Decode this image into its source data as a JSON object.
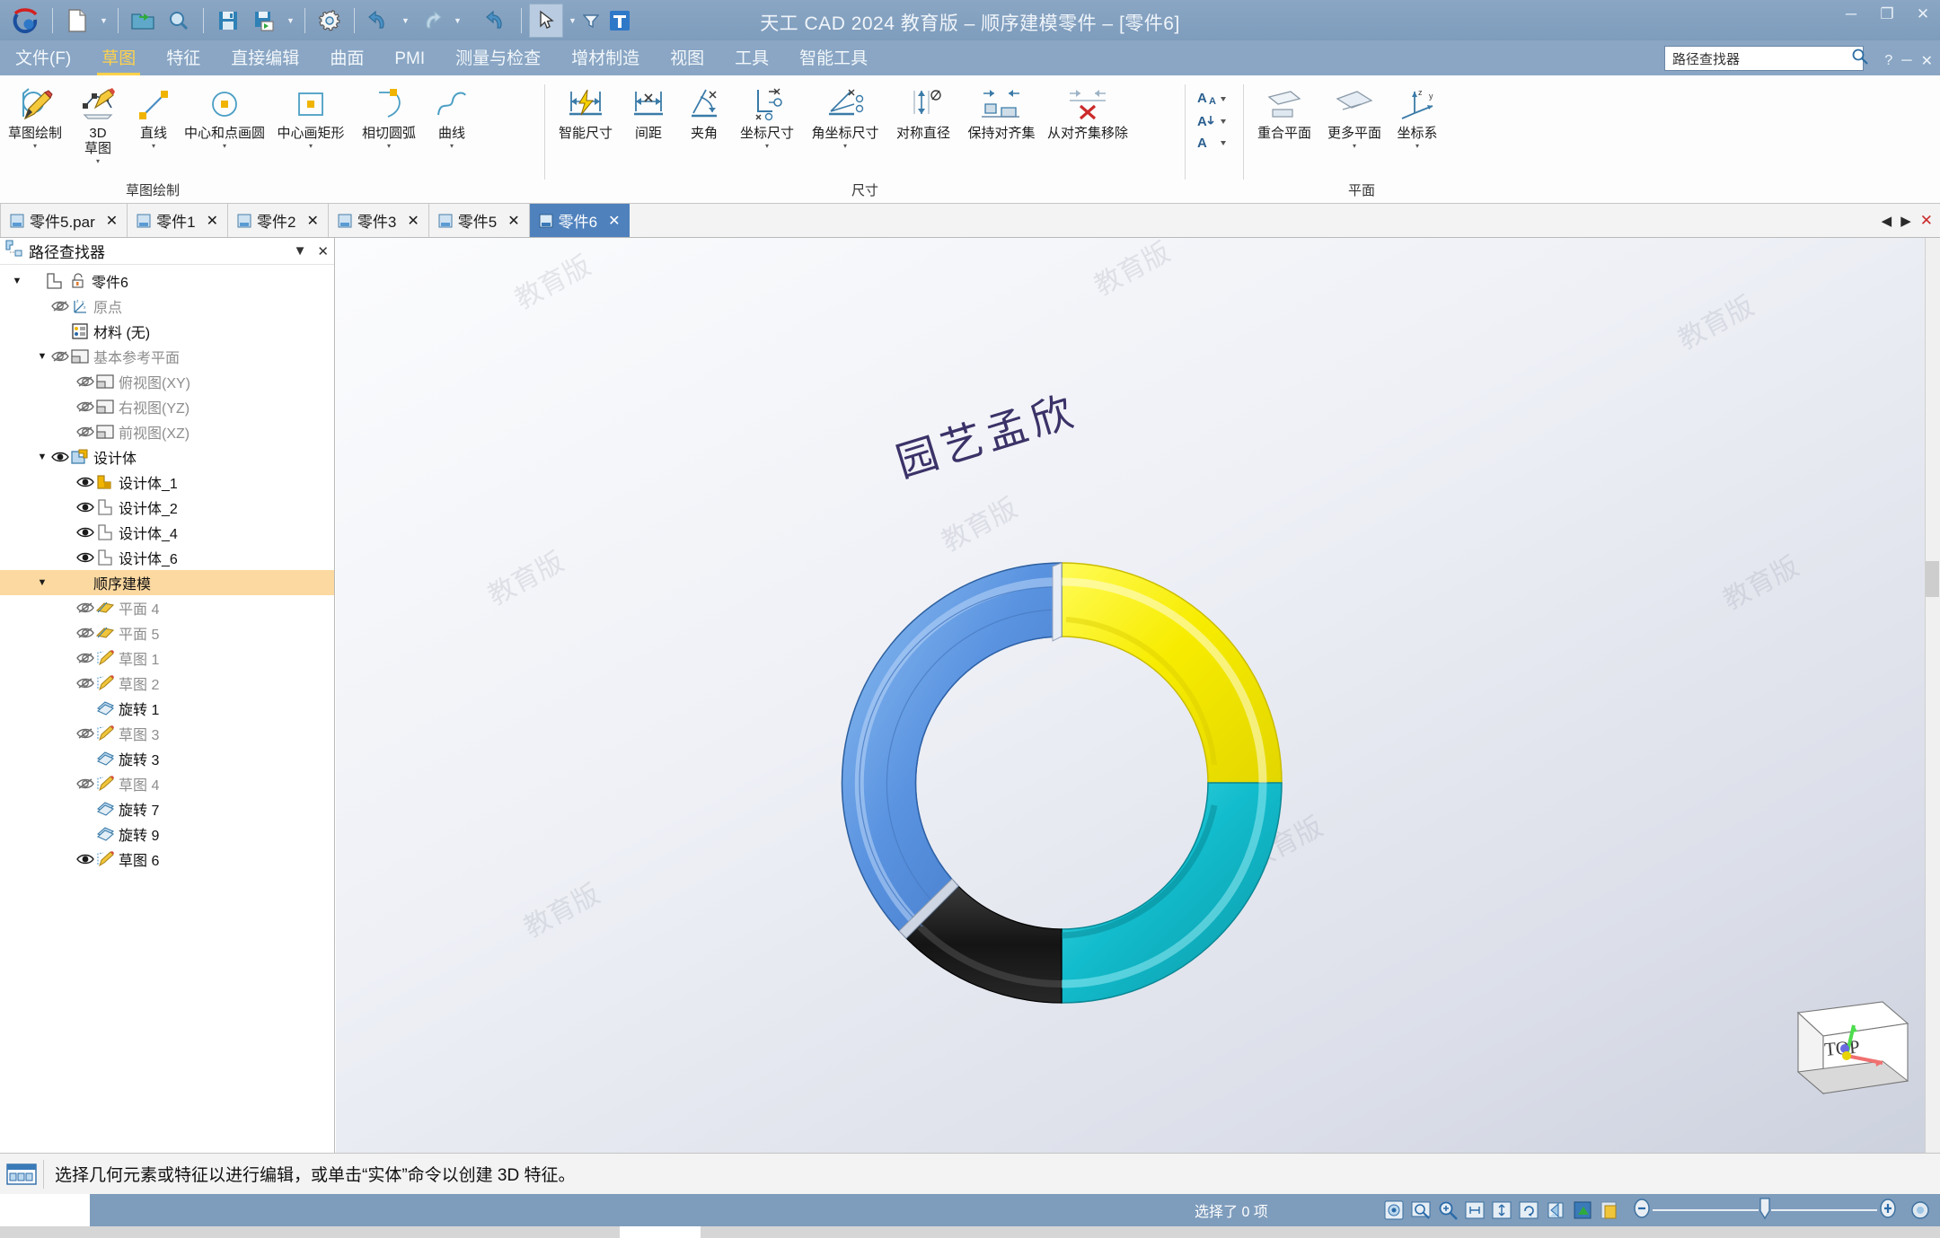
{
  "window": {
    "title": "天工 CAD 2024 教育版 – 顺序建模零件 – [零件6]",
    "minimize": "─",
    "maximize": "❐",
    "close": "✕"
  },
  "quick_access": {
    "items": [
      {
        "name": "app-logo-icon",
        "label": ""
      },
      {
        "name": "new-document-icon",
        "label": ""
      },
      {
        "name": "new-dropdown-caret",
        "label": "▾"
      },
      {
        "name": "open-folder-icon",
        "label": ""
      },
      {
        "name": "print-preview-icon",
        "label": ""
      },
      {
        "name": "save-icon",
        "label": ""
      },
      {
        "name": "save-as-icon",
        "label": ""
      },
      {
        "name": "save-dropdown-caret",
        "label": "▾"
      },
      {
        "name": "settings-gear-icon",
        "label": ""
      },
      {
        "name": "undo-icon",
        "label": ""
      },
      {
        "name": "undo-dropdown-caret",
        "label": "▾"
      },
      {
        "name": "redo-icon",
        "label": ""
      },
      {
        "name": "redo-dropdown-caret",
        "label": "▾"
      },
      {
        "name": "undo-all-icon",
        "label": ""
      },
      {
        "name": "select-arrow-icon",
        "label": ""
      },
      {
        "name": "select-dropdown-caret",
        "label": "▾"
      },
      {
        "name": "filter-icon",
        "label": "▾"
      },
      {
        "name": "text-tool-icon",
        "label": "T"
      }
    ]
  },
  "menu": {
    "items": [
      {
        "label": "文件(F)",
        "active": false
      },
      {
        "label": "草图",
        "active": true
      },
      {
        "label": "特征",
        "active": false
      },
      {
        "label": "直接编辑",
        "active": false
      },
      {
        "label": "曲面",
        "active": false
      },
      {
        "label": "PMI",
        "active": false
      },
      {
        "label": "测量与检查",
        "active": false
      },
      {
        "label": "增材制造",
        "active": false
      },
      {
        "label": "视图",
        "active": false
      },
      {
        "label": "工具",
        "active": false
      },
      {
        "label": "智能工具",
        "active": false
      }
    ],
    "search_value": "路径查找器",
    "search_icon": "search-icon",
    "help_label": "?",
    "restore_label": "─",
    "close_label": "✕"
  },
  "ribbon": {
    "groups": [
      {
        "name": "sketch-draw",
        "label": "草图绘制",
        "buttons": [
          {
            "name": "sketch-draw",
            "icon": "sketch-pencil-icon",
            "line1": "草图绘制",
            "line2": "",
            "dropdown": "▾"
          },
          {
            "name": "sketch-3d",
            "icon": "sketch-3d-icon",
            "line1": "3D",
            "line2": "草图",
            "dropdown": "▾"
          },
          {
            "name": "line-tool",
            "icon": "line-icon",
            "line1": "直线",
            "line2": "",
            "dropdown": "▾"
          },
          {
            "name": "circle-center-point",
            "icon": "circle-icon",
            "line1": "中心和点画圆",
            "line2": "",
            "dropdown": "▾"
          },
          {
            "name": "rectangle-center",
            "icon": "rectangle-icon",
            "line1": "中心画矩形",
            "line2": "",
            "dropdown": "▾"
          },
          {
            "name": "tangent-arc",
            "icon": "arc-icon",
            "line1": "相切圆弧",
            "line2": "",
            "dropdown": "▾"
          },
          {
            "name": "curve-tool",
            "icon": "curve-icon",
            "line1": "曲线",
            "line2": "",
            "dropdown": "▾"
          }
        ]
      },
      {
        "name": "dimension",
        "label": "尺寸",
        "buttons": [
          {
            "name": "smart-dimension",
            "icon": "smart-dimension-icon",
            "line1": "智能尺寸",
            "line2": "",
            "dropdown": ""
          },
          {
            "name": "distance-between",
            "icon": "distance-icon",
            "line1": "间距",
            "line2": "",
            "dropdown": ""
          },
          {
            "name": "angle-between",
            "icon": "angle-icon",
            "line1": "夹角",
            "line2": "",
            "dropdown": ""
          },
          {
            "name": "coordinate-dimension",
            "icon": "coordinate-dimension-icon",
            "line1": "坐标尺寸",
            "line2": "",
            "dropdown": "▾"
          },
          {
            "name": "angular-coordinate-dimension",
            "icon": "angular-coordinate-icon",
            "line1": "角坐标尺寸",
            "line2": "",
            "dropdown": "▾"
          },
          {
            "name": "symmetric-diameter",
            "icon": "symmetric-diameter-icon",
            "line1": "对称直径",
            "line2": "",
            "dropdown": ""
          },
          {
            "name": "maintain-alignment-set",
            "icon": "maintain-align-icon",
            "line1": "保持对齐集",
            "line2": "",
            "dropdown": ""
          },
          {
            "name": "remove-from-alignment-set",
            "icon": "remove-align-icon",
            "line1": "从对齐集移除",
            "line2": "",
            "dropdown": ""
          }
        ]
      },
      {
        "name": "text-format",
        "label": "",
        "buttons": [
          {
            "name": "font-style",
            "icon": "font-style-icon",
            "line1": "",
            "line2": "",
            "dropdown": "▾"
          }
        ]
      },
      {
        "name": "plane",
        "label": "平面",
        "buttons": [
          {
            "name": "coincident-plane",
            "icon": "coincident-plane-icon",
            "line1": "重合平面",
            "line2": "",
            "dropdown": ""
          },
          {
            "name": "more-planes",
            "icon": "more-planes-icon",
            "line1": "更多平面",
            "line2": "",
            "dropdown": "▾"
          },
          {
            "name": "coordinate-system",
            "icon": "coordinate-system-icon",
            "line1": "坐标系",
            "line2": "",
            "dropdown": "▾"
          }
        ]
      }
    ]
  },
  "document_tabs": {
    "tabs": [
      {
        "label": "零件5.par",
        "active": false,
        "close": "✕"
      },
      {
        "label": "零件1",
        "active": false,
        "close": "✕"
      },
      {
        "label": "零件2",
        "active": false,
        "close": "✕"
      },
      {
        "label": "零件3",
        "active": false,
        "close": "✕"
      },
      {
        "label": "零件5",
        "active": false,
        "close": "✕"
      },
      {
        "label": "零件6",
        "active": true,
        "close": "✕"
      }
    ],
    "nav_prev": "◀",
    "nav_next": "▶",
    "nav_close": "✕"
  },
  "pathfinder": {
    "title": "路径查找器",
    "icon": "pathfinder-icon",
    "menu_button": "▼",
    "close_button": "✕",
    "tree": [
      {
        "indent": 0,
        "expander": "▼",
        "eye": "none",
        "icon": "part-icon",
        "label": "零件6",
        "dim": false,
        "highlight": false,
        "lock": "unlock-icon"
      },
      {
        "indent": 1,
        "expander": "",
        "eye": "hidden",
        "icon": "origin-icon",
        "label": "原点",
        "dim": true,
        "highlight": false
      },
      {
        "indent": 1,
        "expander": "",
        "eye": "none",
        "icon": "material-icon",
        "label": "材料 (无)",
        "dim": false,
        "highlight": false
      },
      {
        "indent": 1,
        "expander": "▼",
        "eye": "hidden",
        "icon": "plane-icon",
        "label": "基本参考平面",
        "dim": true,
        "highlight": false
      },
      {
        "indent": 2,
        "expander": "",
        "eye": "hidden",
        "icon": "plane-icon",
        "label": "俯视图(XY)",
        "dim": true,
        "highlight": false
      },
      {
        "indent": 2,
        "expander": "",
        "eye": "hidden",
        "icon": "plane-icon",
        "label": "右视图(YZ)",
        "dim": true,
        "highlight": false
      },
      {
        "indent": 2,
        "expander": "",
        "eye": "hidden",
        "icon": "plane-icon",
        "label": "前视图(XZ)",
        "dim": true,
        "highlight": false
      },
      {
        "indent": 1,
        "expander": "▼",
        "eye": "visible",
        "icon": "design-body-icon",
        "label": "设计体",
        "dim": false,
        "highlight": false
      },
      {
        "indent": 2,
        "expander": "",
        "eye": "visible",
        "icon": "body-yellow-icon",
        "label": "设计体_1",
        "dim": false,
        "highlight": false
      },
      {
        "indent": 2,
        "expander": "",
        "eye": "visible",
        "icon": "body-gray-icon",
        "label": "设计体_2",
        "dim": false,
        "highlight": false
      },
      {
        "indent": 2,
        "expander": "",
        "eye": "visible",
        "icon": "body-gray-icon",
        "label": "设计体_4",
        "dim": false,
        "highlight": false
      },
      {
        "indent": 2,
        "expander": "",
        "eye": "visible",
        "icon": "body-gray-icon",
        "label": "设计体_6",
        "dim": false,
        "highlight": false
      },
      {
        "indent": 1,
        "expander": "▼",
        "eye": "none",
        "icon": "none",
        "label": "顺序建模",
        "dim": false,
        "highlight": true
      },
      {
        "indent": 2,
        "expander": "",
        "eye": "hidden",
        "icon": "plane-feature-icon",
        "label": "平面 4",
        "dim": true,
        "highlight": false
      },
      {
        "indent": 2,
        "expander": "",
        "eye": "hidden",
        "icon": "plane-feature-icon",
        "label": "平面 5",
        "dim": true,
        "highlight": false
      },
      {
        "indent": 2,
        "expander": "",
        "eye": "hidden",
        "icon": "sketch-icon",
        "label": "草图 1",
        "dim": true,
        "highlight": false
      },
      {
        "indent": 2,
        "expander": "",
        "eye": "hidden",
        "icon": "sketch-icon",
        "label": "草图 2",
        "dim": true,
        "highlight": false
      },
      {
        "indent": 2,
        "expander": "",
        "eye": "none",
        "icon": "revolve-icon",
        "label": "旋转 1",
        "dim": false,
        "highlight": false
      },
      {
        "indent": 2,
        "expander": "",
        "eye": "hidden",
        "icon": "sketch-icon",
        "label": "草图 3",
        "dim": true,
        "highlight": false
      },
      {
        "indent": 2,
        "expander": "",
        "eye": "none",
        "icon": "revolve-icon",
        "label": "旋转 3",
        "dim": false,
        "highlight": false
      },
      {
        "indent": 2,
        "expander": "",
        "eye": "hidden",
        "icon": "sketch-icon",
        "label": "草图 4",
        "dim": true,
        "highlight": false
      },
      {
        "indent": 2,
        "expander": "",
        "eye": "none",
        "icon": "revolve-icon",
        "label": "旋转 7",
        "dim": false,
        "highlight": false
      },
      {
        "indent": 2,
        "expander": "",
        "eye": "none",
        "icon": "revolve-icon",
        "label": "旋转 9",
        "dim": false,
        "highlight": false
      },
      {
        "indent": 2,
        "expander": "",
        "eye": "visible",
        "icon": "sketch-icon",
        "label": "草图 6",
        "dim": false,
        "highlight": false
      }
    ]
  },
  "viewport": {
    "owner_text": "园艺孟欣",
    "watermarks": [
      "教育版",
      "教育版",
      "教育版",
      "教育版",
      "教育版",
      "教育版",
      "教育版",
      "教育版"
    ],
    "viewcube_label": "TOP",
    "model_colors": {
      "blue": "#5a93e0",
      "yellow": "#f5ec00",
      "cyan": "#12bccc",
      "black": "#1c1c1c"
    }
  },
  "status": {
    "prompt_icon": "command-bar-icon",
    "prompt": "选择几何元素或特征以进行编辑，或单击“实体”命令以创建 3D 特征。",
    "selection": "选择了 0 项",
    "icons": [
      {
        "name": "view-orientation-icon"
      },
      {
        "name": "zoom-area-icon"
      },
      {
        "name": "zoom-icon"
      },
      {
        "name": "fit-icon"
      },
      {
        "name": "pan-icon"
      },
      {
        "name": "rotate-view-icon"
      },
      {
        "name": "look-at-icon"
      },
      {
        "name": "shade-icon"
      },
      {
        "name": "render-mode-icon"
      }
    ],
    "zoom_minus": "−",
    "zoom_plus": "+"
  }
}
